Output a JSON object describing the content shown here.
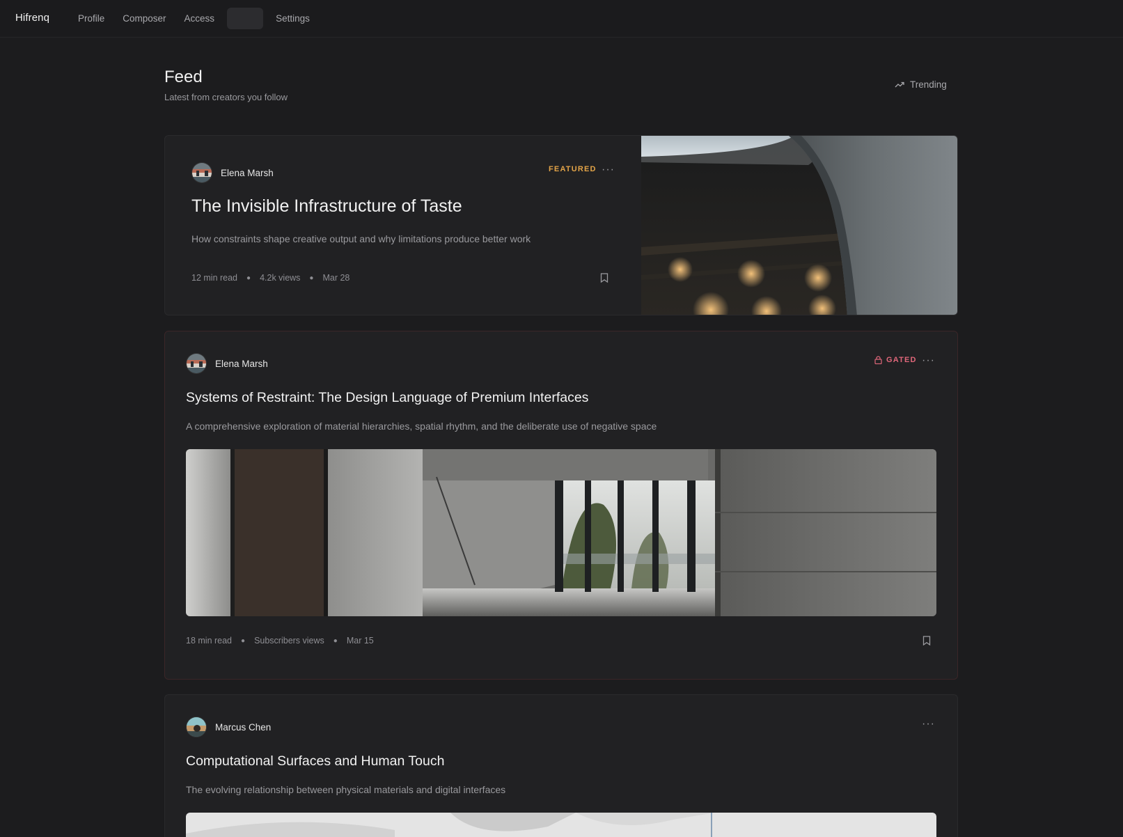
{
  "app": {
    "brand": "Hifrenq"
  },
  "nav": {
    "items": [
      {
        "label": "Profile",
        "active": false
      },
      {
        "label": "Composer",
        "active": false
      },
      {
        "label": "Access",
        "active": false
      },
      {
        "label": "",
        "active": true
      },
      {
        "label": "Settings",
        "active": false
      }
    ]
  },
  "header": {
    "title": "Feed",
    "subtitle": "Latest from creators you follow",
    "trending_label": "Trending",
    "trending_icon": "trending-up-icon"
  },
  "posts": [
    {
      "author": "Elena Marsh",
      "badge": "FEATURED",
      "badge_color": "#e3a448",
      "title": "The Invisible Infrastructure of Taste",
      "description": "How constraints shape creative output and why limitations produce better work",
      "read_time": "12 min read",
      "views": "4.2k views",
      "date": "Mar 28"
    },
    {
      "author": "Elena Marsh",
      "badge": "GATED",
      "badge_color": "#e0677a",
      "badge_icon": "lock-icon",
      "title": "Systems of Restraint: The Design Language of Premium Interfaces",
      "description": "A comprehensive exploration of material hierarchies, spatial rhythm, and the deliberate use of negative space",
      "read_time": "18 min read",
      "views": "Subscribers views",
      "date": "Mar 15"
    },
    {
      "author": "Marcus Chen",
      "title": "Computational Surfaces and Human Touch",
      "description": "The evolving relationship between physical materials and digital interfaces"
    }
  ]
}
